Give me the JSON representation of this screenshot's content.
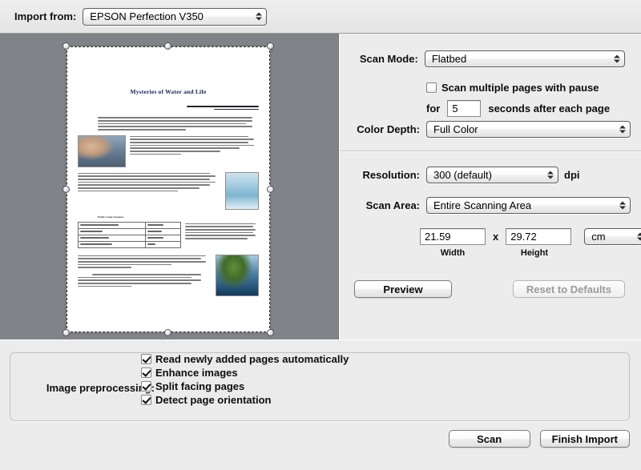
{
  "header": {
    "import_from_label": "Import from:",
    "device": "EPSON Perfection V350"
  },
  "preview": {
    "document": {
      "title": "Mysteries of Water and Life",
      "section_heading": "Earth's water resources"
    }
  },
  "settings": {
    "scan_mode_label": "Scan Mode:",
    "scan_mode_value": "Flatbed",
    "multipage_checkbox_label": "Scan multiple pages with pause",
    "multipage_checked": false,
    "for_label": "for",
    "seconds_value": "5",
    "seconds_suffix": "seconds after each page",
    "color_depth_label": "Color Depth:",
    "color_depth_value": "Full Color",
    "resolution_label": "Resolution:",
    "resolution_value": "300 (default)",
    "resolution_unit": "dpi",
    "scan_area_label": "Scan Area:",
    "scan_area_value": "Entire Scanning Area",
    "width_value": "21.59",
    "width_caption": "Width",
    "dimension_separator": "x",
    "height_value": "29.72",
    "height_caption": "Height",
    "units_value": "cm",
    "preview_button": "Preview",
    "reset_button": "Reset to Defaults",
    "reset_button_disabled": true
  },
  "preprocessing": {
    "label": "Image preprocessing:",
    "options": [
      {
        "label": "Read newly added pages automatically",
        "checked": true
      },
      {
        "label": "Enhance images",
        "checked": true
      },
      {
        "label": "Split facing pages",
        "checked": true
      },
      {
        "label": "Detect page orientation",
        "checked": true
      }
    ]
  },
  "footer": {
    "scan_button": "Scan",
    "finish_import_button": "Finish Import"
  },
  "colors": {
    "preview_background": "#808387",
    "panel_background": "#ececec",
    "document_title": "#16205a"
  }
}
